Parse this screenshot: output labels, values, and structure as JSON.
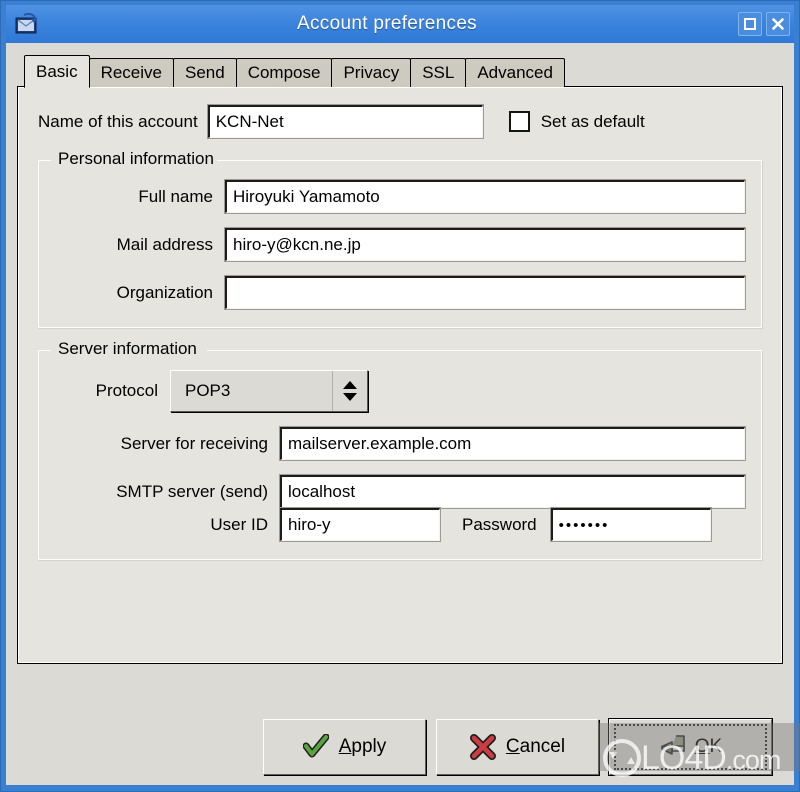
{
  "window": {
    "title": "Account preferences",
    "icon": "mail-account-icon",
    "controls": {
      "maximize": "maximize-icon",
      "close": "close-icon"
    }
  },
  "tabs": [
    {
      "label": "Basic",
      "active": true
    },
    {
      "label": "Receive",
      "active": false
    },
    {
      "label": "Send",
      "active": false
    },
    {
      "label": "Compose",
      "active": false
    },
    {
      "label": "Privacy",
      "active": false
    },
    {
      "label": "SSL",
      "active": false
    },
    {
      "label": "Advanced",
      "active": false
    }
  ],
  "basic": {
    "account_name": {
      "label": "Name of this account",
      "value": "KCN-Net",
      "placeholder": ""
    },
    "set_as_default": {
      "label": "Set as default",
      "checked": false
    },
    "personal": {
      "title": "Personal information",
      "fields": [
        {
          "label": "Full name",
          "value": "Hiroyuki Yamamoto",
          "placeholder": ""
        },
        {
          "label": "Mail address",
          "value": "hiro-y@kcn.ne.jp",
          "placeholder": ""
        },
        {
          "label": "Organization",
          "value": "",
          "placeholder": ""
        }
      ]
    },
    "server": {
      "title": "Server information",
      "protocol": {
        "label": "Protocol",
        "value": "POP3"
      },
      "fields": [
        {
          "label": "Server for receiving",
          "value": "mailserver.example.com",
          "placeholder": ""
        },
        {
          "label": "SMTP server (send)",
          "value": "localhost",
          "placeholder": ""
        }
      ],
      "user_id": {
        "label": "User ID",
        "value": "hiro-y",
        "placeholder": ""
      },
      "password": {
        "label": "Password",
        "value": "•••••••",
        "placeholder": ""
      }
    }
  },
  "actions": [
    {
      "label_pre": "",
      "accel": "A",
      "label_post": "pply",
      "icon": "green-check-icon",
      "focused": false
    },
    {
      "label_pre": "",
      "accel": "C",
      "label_post": "ancel",
      "icon": "red-cross-icon",
      "focused": false
    },
    {
      "label_pre": "",
      "accel": "O",
      "label_post": "K",
      "icon": "enter-arrow-icon",
      "focused": true
    }
  ],
  "watermark": {
    "text": "LO4D",
    "suffix": ".com",
    "logo": "lo4d-circular-arrow-icon"
  },
  "colors": {
    "titlebar": "#3c84dd",
    "frame": "#3a7fd0",
    "dialog_bg": "#dcdad5",
    "panel_bg": "#e6e4df",
    "tab_inactive": "#cdcabf",
    "field_bg": "#ffffff",
    "apply_icon": "#4f9a3c",
    "cancel_icon": "#c4343c",
    "ok_icon": "#8b9473"
  }
}
